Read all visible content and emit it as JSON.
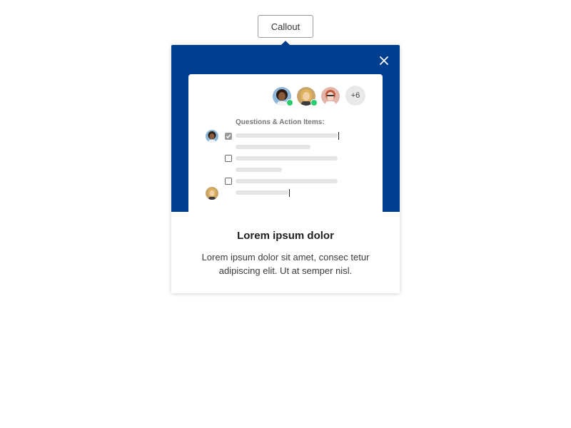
{
  "trigger": {
    "label": "Callout"
  },
  "callout": {
    "title": "Lorem ipsum dolor",
    "description": "Lorem ipsum dolor sit amet, consec tetur adipiscing elit. Ut at semper nisl.",
    "accent_color": "#003e8f",
    "close_icon": "close-icon"
  },
  "illustration": {
    "participants_more": "+6",
    "section_title": "Questions & Action Items:",
    "online_color": "#2ecc71",
    "items": [
      {
        "checked": true
      },
      {
        "checked": false
      },
      {
        "checked": false
      }
    ]
  }
}
